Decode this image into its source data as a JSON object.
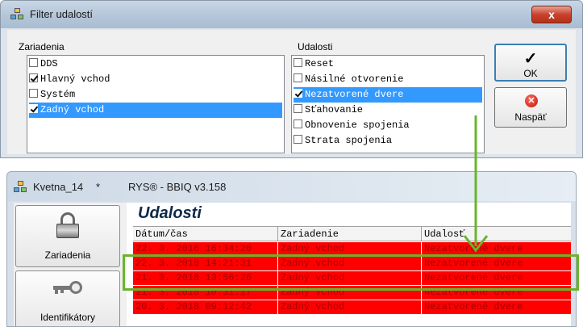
{
  "filter_dialog": {
    "title": "Filter udalostí",
    "close_label": "x",
    "devices": {
      "label": "Zariadenia",
      "items": [
        {
          "label": "DDS",
          "checked": false,
          "selected": false
        },
        {
          "label": "Hlavný vchod",
          "checked": true,
          "selected": false
        },
        {
          "label": "Systém",
          "checked": false,
          "selected": false
        },
        {
          "label": "Zadný vchod",
          "checked": true,
          "selected": true
        }
      ]
    },
    "events": {
      "label": "Udalosti",
      "items": [
        {
          "label": "Reset",
          "checked": false,
          "selected": false
        },
        {
          "label": "Násilné otvorenie",
          "checked": false,
          "selected": false
        },
        {
          "label": "Nezatvorené dvere",
          "checked": true,
          "selected": true
        },
        {
          "label": "Sťahovanie",
          "checked": false,
          "selected": false
        },
        {
          "label": "Obnovenie spojenia",
          "checked": false,
          "selected": false
        },
        {
          "label": "Strata spojenia",
          "checked": false,
          "selected": false
        }
      ]
    },
    "ok_icon": "✓",
    "ok_label": "OK",
    "back_icon": "✕",
    "back_label": "Naspäť"
  },
  "main_window": {
    "project": "Kvetna_14",
    "modified_marker": "*",
    "app_title": "RYS® - BBIQ v3.158",
    "heading": "Udalosti",
    "sidebar": [
      {
        "label": "Zariadenia",
        "icon": "padlock-icon"
      },
      {
        "label": "Identifikátory",
        "icon": "keys-icon"
      }
    ],
    "table": {
      "columns": [
        "Dátum/čas",
        "Zariadenie",
        "Udalosť"
      ],
      "rows": [
        [
          "22. 3. 2018 16:34:20",
          "Zadný vchod",
          "Nezatvorené dvere"
        ],
        [
          "22. 3. 2018 14:21:31",
          "Zadný vchod",
          "Nezatvorené dvere"
        ],
        [
          "21. 3. 2018 13:56:26",
          "Zadný vchod",
          "Nezatvorené dvere"
        ],
        [
          "21. 3. 2018 10:31:17",
          "Zadný vchod",
          "Nezatvorené dvere"
        ],
        [
          "20. 3. 2018 09:12:42",
          "Zadný vchod",
          "Nezatvorené dvere"
        ]
      ]
    }
  },
  "colors": {
    "highlight": "#6ab42c",
    "row_bg": "#ff0000",
    "row_text": "#a80000",
    "selection": "#3399ff"
  }
}
